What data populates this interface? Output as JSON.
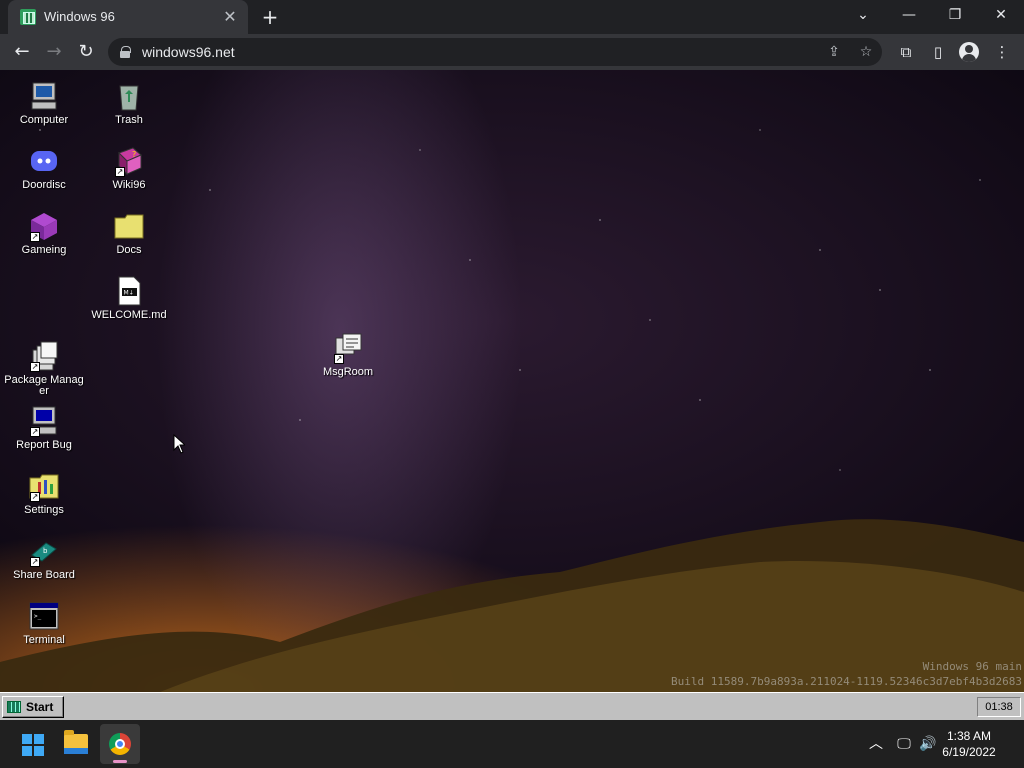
{
  "browser": {
    "tab_title": "Windows 96",
    "url": "windows96.net",
    "close_glyph": "✕",
    "newtab_glyph": "+",
    "back_glyph": "←",
    "forward_glyph": "→",
    "reload_glyph": "↻",
    "tabsearch_glyph": "⌄",
    "minimize_glyph": "—",
    "restore_glyph": "❐",
    "window_close_glyph": "✕",
    "share_glyph": "⇪",
    "star_glyph": "☆",
    "extensions_glyph": "⧉",
    "sidepanel_glyph": "▯",
    "menu_glyph": "⋮"
  },
  "desktop": {
    "icons": [
      {
        "label": "Computer",
        "icon": "computer-icon"
      },
      {
        "label": "Trash",
        "icon": "trash-icon"
      },
      {
        "label": "Doordisc",
        "icon": "discord-icon"
      },
      {
        "label": "Wiki96",
        "icon": "book-icon"
      },
      {
        "label": "Gameing",
        "icon": "cube-icon"
      },
      {
        "label": "Docs",
        "icon": "folder-icon"
      },
      {
        "label": "WELCOME.md",
        "icon": "markdown-file-icon"
      },
      {
        "label": "MsgRoom",
        "icon": "chat-icon"
      },
      {
        "label": "Package Manager",
        "icon": "package-icon"
      },
      {
        "label": "Report Bug",
        "icon": "bug-report-icon"
      },
      {
        "label": "Settings",
        "icon": "settings-icon"
      },
      {
        "label": "Share Board",
        "icon": "share-board-icon"
      },
      {
        "label": "Terminal",
        "icon": "terminal-icon"
      }
    ],
    "watermark_line1": "Windows 96 main",
    "watermark_line2": "Build 11589.7b9a893a.211024-1119.52346c3d7ebf4b3d2683"
  },
  "w96_taskbar": {
    "start_label": "Start",
    "clock": "01:38"
  },
  "os_taskbar": {
    "time": "1:38 AM",
    "date": "6/19/2022",
    "chevron_glyph": "︿",
    "network_glyph": "🖵",
    "volume_glyph": "🔊"
  },
  "colors": {
    "chrome_dark": "#202124",
    "chrome_toolbar": "#35363a",
    "w96_gray": "#c0c0c0",
    "os_taskbar": "#202020"
  }
}
